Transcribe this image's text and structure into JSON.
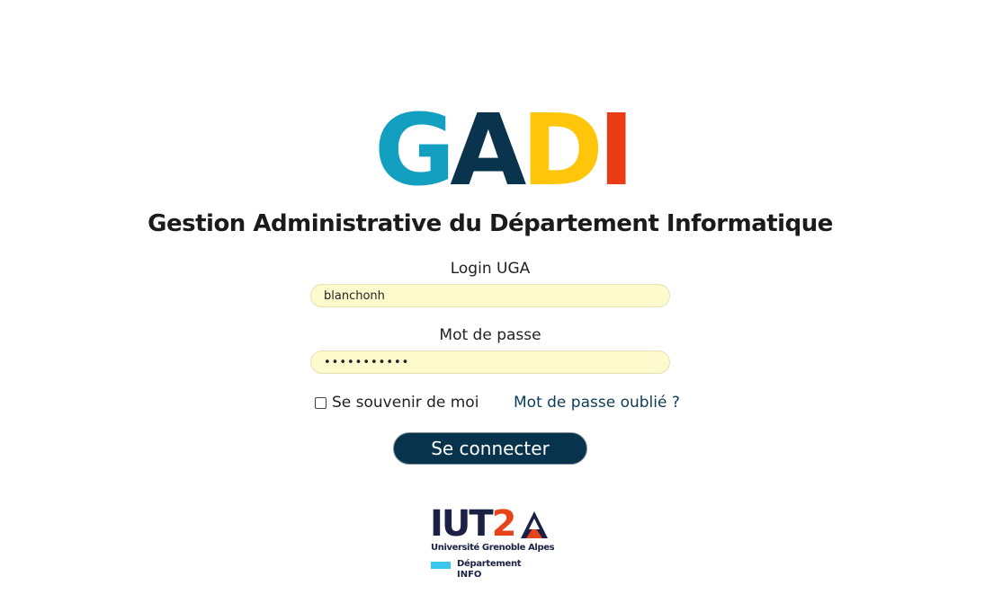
{
  "app": {
    "logo_letters": [
      "G",
      "A",
      "D",
      "I"
    ],
    "logo_colors": [
      "#129fc0",
      "#0a334d",
      "#ffc60b",
      "#ea3d15"
    ],
    "subtitle": "Gestion Administrative du Département Informatique"
  },
  "login_form": {
    "login_label": "Login UGA",
    "login_value": "blanchonh",
    "password_label": "Mot de passe",
    "password_value": "•••••••••••",
    "remember_label": "Se souvenir de moi",
    "remember_checked": false,
    "forgot_link": "Mot de passe oublié ?",
    "submit_label": "Se connecter"
  },
  "footer_logo": {
    "iut_text": "IUT",
    "iut_number": "2",
    "university": "Université Grenoble Alpes",
    "department_line1": "Département",
    "department_line2": "INFO",
    "colors": {
      "navy": "#1a2145",
      "orange": "#e8441c",
      "cyan": "#3ac6ee"
    }
  },
  "colors": {
    "button_bg": "#08334c",
    "input_bg": "#fdfacd",
    "link": "#0d3c58"
  }
}
